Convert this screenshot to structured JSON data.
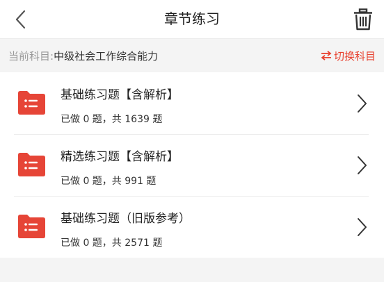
{
  "header": {
    "title": "章节练习",
    "back_icon": "chevron-left-icon",
    "trash_icon": "trash-icon"
  },
  "subject": {
    "label": "当前科目:",
    "name": "中级社会工作综合能力",
    "switch_label": "切换科目",
    "switch_icon": "swap-arrows-icon"
  },
  "colors": {
    "accent": "#e8412f",
    "folder": "#e64537"
  },
  "items": [
    {
      "title": "基础练习题【含解析】",
      "count": "已做 0 题，共 1639 题"
    },
    {
      "title": "精选练习题【含解析】",
      "count": "已做 0 题，共 991 题"
    },
    {
      "title": "基础练习题（旧版参考）",
      "count": "已做 0 题，共 2571 题"
    }
  ]
}
